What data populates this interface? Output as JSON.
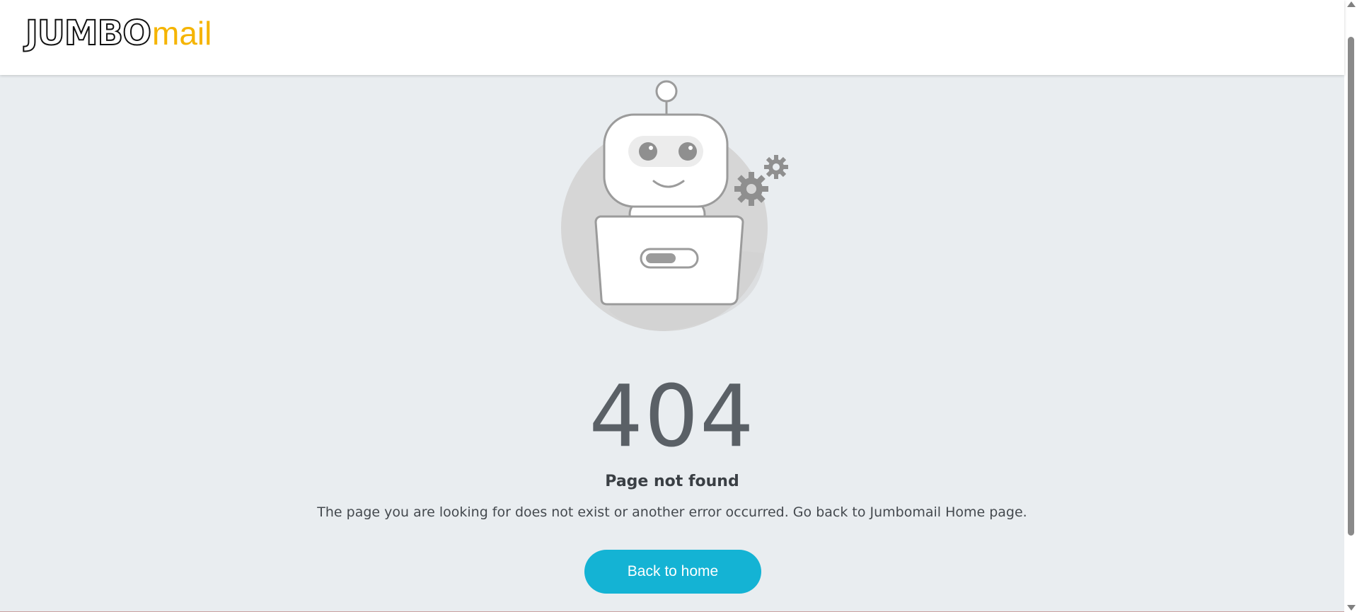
{
  "header": {
    "logo_primary": "JUMBO",
    "logo_secondary": "mail"
  },
  "error": {
    "code": "404",
    "title": "Page not found",
    "description": "The page you are looking for does not exist or another error occurred. Go back to Jumbomail Home page."
  },
  "actions": {
    "back_home_label": "Back to home"
  },
  "colors": {
    "background": "#e9edf0",
    "accent_button": "#14b3d4",
    "logo_mail": "#f5b400",
    "code_text": "#5a6066"
  },
  "icons": [
    "robot-illustration",
    "gear-icon"
  ]
}
